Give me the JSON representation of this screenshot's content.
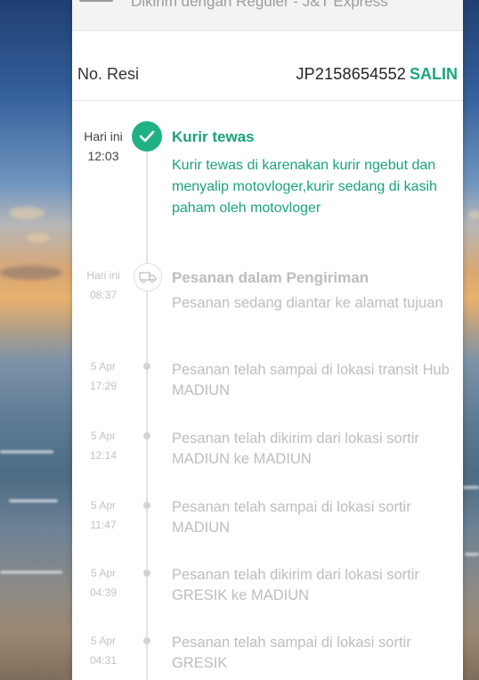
{
  "header": {
    "service_text": "Dikirim dengan Reguler - J&T Express"
  },
  "resi": {
    "label": "No. Resi",
    "number": "JP2158654552",
    "copy_label": "SALIN"
  },
  "current": {
    "day": "Hari ini",
    "time": "12:03",
    "title": "Kurir tewas",
    "description": "Kurir tewas di karenakan kurir ngebut dan menyalip motovloger,kurir sedang di kasih paham oleh motovloger"
  },
  "delivery": {
    "day": "Hari ini",
    "time": "08:37",
    "title": "Pesanan dalam Pengiriman",
    "description": "Pesanan sedang diantar ke alamat tujuan"
  },
  "history": [
    {
      "day": "5 Apr",
      "time": "17:29",
      "description": "Pesanan telah sampai di lokasi transit Hub MADIUN"
    },
    {
      "day": "5 Apr",
      "time": "12:14",
      "description": "Pesanan telah dikirim dari lokasi sortir MADIUN ke MADIUN"
    },
    {
      "day": "5 Apr",
      "time": "11:47",
      "description": "Pesanan telah sampai di lokasi sortir MADIUN"
    },
    {
      "day": "5 Apr",
      "time": "04:39",
      "description": "Pesanan telah dikirim dari lokasi sortir GRESIK ke MADIUN"
    },
    {
      "day": "5 Apr",
      "time": "04:31",
      "description": "Pesanan telah sampai di lokasi sortir GRESIK"
    }
  ],
  "colors": {
    "accent": "#1aa67e",
    "muted_text": "#bdbdbd"
  },
  "icons": {
    "current_status": "check-icon",
    "delivery_status": "truck-icon"
  }
}
